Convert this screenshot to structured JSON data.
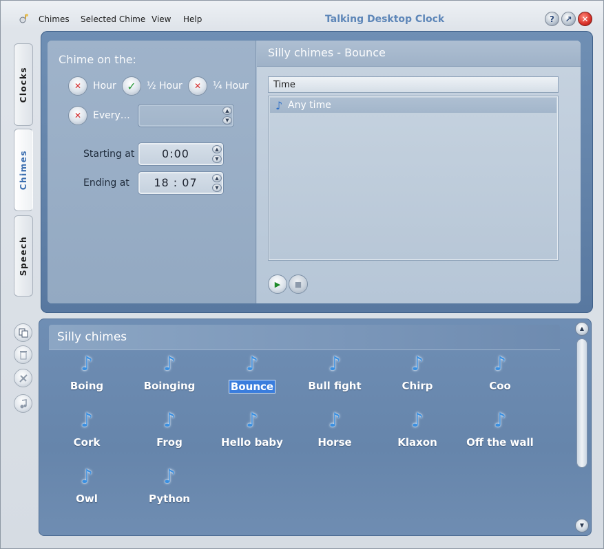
{
  "window": {
    "title": "Talking Desktop Clock",
    "menu": [
      "Chimes",
      "Selected Chime",
      "View",
      "Help"
    ],
    "help_btn": "?",
    "mini_btn": "↗",
    "close_btn": "✕"
  },
  "tabs": [
    {
      "label": "Clocks",
      "active": false
    },
    {
      "label": "Chimes",
      "active": true
    },
    {
      "label": "Speech",
      "active": false
    }
  ],
  "chime_on": {
    "title": "Chime on the:",
    "options": [
      {
        "label": "Hour",
        "checked": false
      },
      {
        "label": "½ Hour",
        "checked": true
      },
      {
        "label": "¼ Hour",
        "checked": false
      },
      {
        "label": "Every…",
        "checked": false
      }
    ],
    "every_value": "",
    "starting_label": "Starting at",
    "starting_value": "0:00",
    "ending_label": "Ending at",
    "ending_value": "18 : 07"
  },
  "selected": {
    "title": "Silly chimes - Bounce",
    "column": "Time",
    "rows": [
      "Any time"
    ]
  },
  "group": {
    "title": "Silly chimes",
    "sounds": [
      "Boing",
      "Boinging",
      "Bounce",
      "Bull fight",
      "Chirp",
      "Coo",
      "Cork",
      "Frog",
      "Hello baby",
      "Horse",
      "Klaxon",
      "Off the wall",
      "Owl",
      "Python"
    ],
    "selected_index": 2
  },
  "icons": {
    "note": "♪",
    "check": "✓",
    "cross": "✕",
    "play": "▶",
    "stop": "■",
    "up": "▲",
    "down": "▼"
  },
  "colors": {
    "title": "#5d86b8",
    "panel": "#6685ab",
    "selection": "#3a7ddd"
  }
}
